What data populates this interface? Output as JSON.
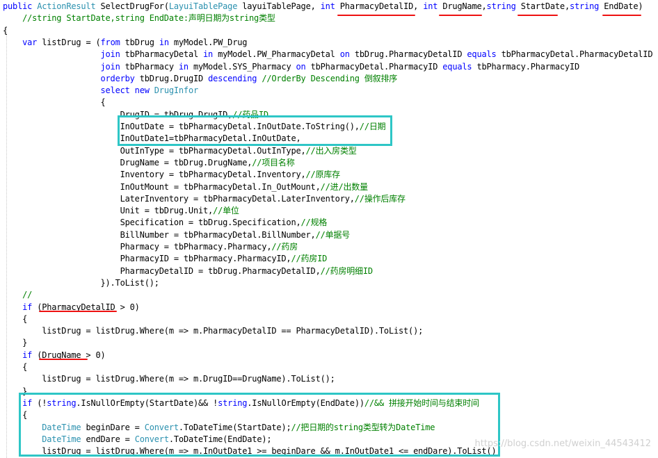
{
  "code_lines": [
    [
      {
        "t": "public ",
        "c": "kw"
      },
      {
        "t": "ActionResult ",
        "c": "ty"
      },
      {
        "t": "SelectDrugFor(",
        "c": "tx"
      },
      {
        "t": "LayuiTablePage",
        "c": "ty"
      },
      {
        "t": " layuiTablePage, ",
        "c": "tx"
      },
      {
        "t": "int ",
        "c": "kw"
      },
      {
        "t": "PharmacyDetalID",
        "c": "tx"
      },
      {
        "t": ", ",
        "c": "tx"
      },
      {
        "t": "int ",
        "c": "kw"
      },
      {
        "t": "DrugName",
        "c": "tx"
      },
      {
        "t": ",",
        "c": "tx"
      },
      {
        "t": "string ",
        "c": "kw"
      },
      {
        "t": "StartDate",
        "c": "tx"
      },
      {
        "t": ",",
        "c": "tx"
      },
      {
        "t": "string ",
        "c": "kw"
      },
      {
        "t": "EndDate",
        "c": "tx"
      },
      {
        "t": ")",
        "c": "tx"
      }
    ],
    [
      {
        "t": "    //string StartDate,string EndDate:声明日期为string类型",
        "c": "cm"
      }
    ],
    [
      {
        "t": "{",
        "c": "tx"
      }
    ],
    [
      {
        "t": "    ",
        "c": "tx"
      },
      {
        "t": "var ",
        "c": "kw"
      },
      {
        "t": "listDrug = (",
        "c": "tx"
      },
      {
        "t": "from ",
        "c": "kw"
      },
      {
        "t": "tbDrug ",
        "c": "tx"
      },
      {
        "t": "in ",
        "c": "kw"
      },
      {
        "t": "myModel.PW_Drug",
        "c": "tx"
      }
    ],
    [
      {
        "t": "                    ",
        "c": "tx"
      },
      {
        "t": "join ",
        "c": "kw"
      },
      {
        "t": "tbPharmacyDetal ",
        "c": "tx"
      },
      {
        "t": "in ",
        "c": "kw"
      },
      {
        "t": "myModel.PW_PharmacyDetal ",
        "c": "tx"
      },
      {
        "t": "on ",
        "c": "kw"
      },
      {
        "t": "tbDrug.PharmacyDetalID ",
        "c": "tx"
      },
      {
        "t": "equals ",
        "c": "kw"
      },
      {
        "t": "tbPharmacyDetal.PharmacyDetalID",
        "c": "tx"
      }
    ],
    [
      {
        "t": "                    ",
        "c": "tx"
      },
      {
        "t": "join ",
        "c": "kw"
      },
      {
        "t": "tbPharmacy ",
        "c": "tx"
      },
      {
        "t": "in ",
        "c": "kw"
      },
      {
        "t": "myModel.SYS_Pharmacy ",
        "c": "tx"
      },
      {
        "t": "on ",
        "c": "kw"
      },
      {
        "t": "tbPharmacyDetal.PharmacyID ",
        "c": "tx"
      },
      {
        "t": "equals ",
        "c": "kw"
      },
      {
        "t": "tbPharmacy.PharmacyID",
        "c": "tx"
      }
    ],
    [
      {
        "t": "                    ",
        "c": "tx"
      },
      {
        "t": "orderby ",
        "c": "kw"
      },
      {
        "t": "tbDrug.DrugID ",
        "c": "tx"
      },
      {
        "t": "descending ",
        "c": "kw"
      },
      {
        "t": "//OrderBy Descending 倒叙排序",
        "c": "cm"
      }
    ],
    [
      {
        "t": "                    ",
        "c": "tx"
      },
      {
        "t": "select new ",
        "c": "kw"
      },
      {
        "t": "DrugInfor",
        "c": "ty"
      }
    ],
    [
      {
        "t": "                    {",
        "c": "tx"
      }
    ],
    [
      {
        "t": "                        DrugID = tbDrug.DrugID,",
        "c": "tx"
      },
      {
        "t": "//药品ID",
        "c": "cm"
      }
    ],
    [
      {
        "t": "                        InOutDate = tbPharmacyDetal.InOutDate.ToString(),",
        "c": "tx"
      },
      {
        "t": "//日期",
        "c": "cm"
      }
    ],
    [
      {
        "t": "                        InOutDate1=tbPharmacyDetal.InOutDate,",
        "c": "tx"
      }
    ],
    [
      {
        "t": "                        OutInType = tbPharmacyDetal.OutInType,",
        "c": "tx"
      },
      {
        "t": "//出入房类型",
        "c": "cm"
      }
    ],
    [
      {
        "t": "                        DrugName = tbDrug.DrugName,",
        "c": "tx"
      },
      {
        "t": "//项目名称",
        "c": "cm"
      }
    ],
    [
      {
        "t": "                        Inventory = tbPharmacyDetal.Inventory,",
        "c": "tx"
      },
      {
        "t": "//原库存",
        "c": "cm"
      }
    ],
    [
      {
        "t": "                        InOutMount = tbPharmacyDetal.In_OutMount,",
        "c": "tx"
      },
      {
        "t": "//进/出数量",
        "c": "cm"
      }
    ],
    [
      {
        "t": "                        LaterInventory = tbPharmacyDetal.LaterInventory,",
        "c": "tx"
      },
      {
        "t": "//操作后库存",
        "c": "cm"
      }
    ],
    [
      {
        "t": "                        Unit = tbDrug.Unit,",
        "c": "tx"
      },
      {
        "t": "//单位",
        "c": "cm"
      }
    ],
    [
      {
        "t": "                        Specification = tbDrug.Specification,",
        "c": "tx"
      },
      {
        "t": "//规格",
        "c": "cm"
      }
    ],
    [
      {
        "t": "                        BillNumber = tbPharmacyDetal.BillNumber,",
        "c": "tx"
      },
      {
        "t": "//单据号",
        "c": "cm"
      }
    ],
    [
      {
        "t": "                        Pharmacy = tbPharmacy.Pharmacy,",
        "c": "tx"
      },
      {
        "t": "//药房",
        "c": "cm"
      }
    ],
    [
      {
        "t": "                        PharmacyID = tbPharmacy.PharmacyID,",
        "c": "tx"
      },
      {
        "t": "//药房ID",
        "c": "cm"
      }
    ],
    [
      {
        "t": "                        PharmacyDetalID = tbDrug.PharmacyDetalID,",
        "c": "tx"
      },
      {
        "t": "//药房明细ID",
        "c": "cm"
      }
    ],
    [
      {
        "t": "                    }).ToList();",
        "c": "tx"
      }
    ],
    [
      {
        "t": "    //",
        "c": "cm"
      }
    ],
    [
      {
        "t": "    ",
        "c": "tx"
      },
      {
        "t": "if ",
        "c": "kw"
      },
      {
        "t": "(PharmacyDetalID > 0)",
        "c": "tx"
      }
    ],
    [
      {
        "t": "    {",
        "c": "tx"
      }
    ],
    [
      {
        "t": "        listDrug = listDrug.Where(m => m.PharmacyDetalID == PharmacyDetalID).ToList();",
        "c": "tx"
      }
    ],
    [
      {
        "t": "    }",
        "c": "tx"
      }
    ],
    [
      {
        "t": "    ",
        "c": "tx"
      },
      {
        "t": "if ",
        "c": "kw"
      },
      {
        "t": "(DrugName > 0)",
        "c": "tx"
      }
    ],
    [
      {
        "t": "    {",
        "c": "tx"
      }
    ],
    [
      {
        "t": "        listDrug = listDrug.Where(m => m.DrugID==DrugName).ToList();",
        "c": "tx"
      }
    ],
    [
      {
        "t": "    }",
        "c": "tx"
      }
    ],
    [
      {
        "t": "    ",
        "c": "tx"
      },
      {
        "t": "if ",
        "c": "kw"
      },
      {
        "t": "(!",
        "c": "tx"
      },
      {
        "t": "string",
        "c": "kw"
      },
      {
        "t": ".IsNullOrEmpty(StartDate)&& !",
        "c": "tx"
      },
      {
        "t": "string",
        "c": "kw"
      },
      {
        "t": ".IsNullOrEmpty(EndDate))",
        "c": "tx"
      },
      {
        "t": "//&& 拼接开始时间与结束时间",
        "c": "cm"
      }
    ],
    [
      {
        "t": "    {",
        "c": "tx"
      }
    ],
    [
      {
        "t": "        ",
        "c": "tx"
      },
      {
        "t": "DateTime ",
        "c": "ty"
      },
      {
        "t": "beginDare = ",
        "c": "tx"
      },
      {
        "t": "Convert",
        "c": "ty"
      },
      {
        "t": ".ToDateTime(StartDate);",
        "c": "tx"
      },
      {
        "t": "//把日期的string类型转为DateTime",
        "c": "cm"
      }
    ],
    [
      {
        "t": "        ",
        "c": "tx"
      },
      {
        "t": "DateTime ",
        "c": "ty"
      },
      {
        "t": "endDare = ",
        "c": "tx"
      },
      {
        "t": "Convert",
        "c": "ty"
      },
      {
        "t": ".ToDateTime(EndDate);",
        "c": "tx"
      }
    ],
    [
      {
        "t": "        listDrug = listDrug.Where(m => m.InOutDate1 >= beginDare && m.InOutDate1 <= endDare).ToList();",
        "c": "tx"
      }
    ]
  ],
  "watermark": "https://blog.csdn.net/weixin_44543412",
  "colors": {
    "keyword": "#0000ff",
    "type": "#2b91af",
    "comment": "#008000",
    "text": "#000000",
    "annotation_box": "#2ec6c6",
    "annotation_underline": "#ee1111"
  }
}
